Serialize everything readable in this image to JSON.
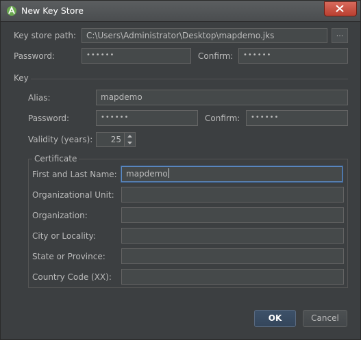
{
  "window": {
    "title": "New Key Store"
  },
  "keystore": {
    "path_label": "Key store path:",
    "path_value": "C:\\Users\\Administrator\\Desktop\\mapdemo.jks",
    "browse_label": "...",
    "password_label": "Password:",
    "password_value": "••••••",
    "confirm_label": "Confirm:",
    "confirm_value": "••••••"
  },
  "key": {
    "section_label": "Key",
    "alias_label": "Alias:",
    "alias_value": "mapdemo",
    "password_label": "Password:",
    "password_value": "••••••",
    "confirm_label": "Confirm:",
    "confirm_value": "••••••",
    "validity_label": "Validity (years):",
    "validity_value": "25"
  },
  "certificate": {
    "section_label": "Certificate",
    "fields": [
      {
        "label": "First and Last Name:",
        "value": "mapdemo"
      },
      {
        "label": "Organizational Unit:",
        "value": ""
      },
      {
        "label": "Organization:",
        "value": ""
      },
      {
        "label": "City or Locality:",
        "value": ""
      },
      {
        "label": "State or Province:",
        "value": ""
      },
      {
        "label": "Country Code (XX):",
        "value": ""
      }
    ]
  },
  "buttons": {
    "ok": "OK",
    "cancel": "Cancel"
  },
  "colors": {
    "background": "#3c3f41",
    "field": "#45494a",
    "text": "#bbbbbb",
    "focus": "#5d8bc4",
    "close": "#c7483a"
  },
  "icons": {
    "app": "android-studio-icon",
    "close": "close-icon"
  }
}
